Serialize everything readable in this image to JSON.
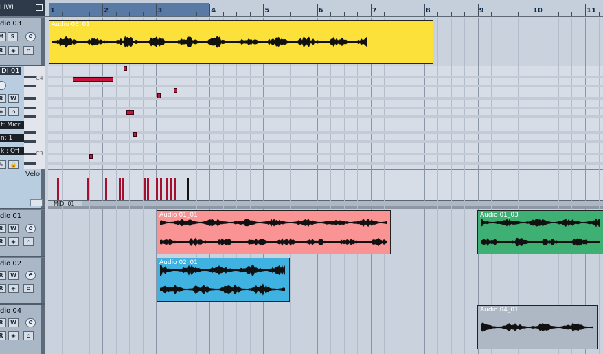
{
  "topleft": {
    "label": "I IWI"
  },
  "ruler": {
    "bars": [
      "1",
      "2",
      "3",
      "4",
      "5",
      "6",
      "7",
      "8",
      "9",
      "10",
      "11"
    ],
    "locators": {
      "left_bar": 1,
      "right_bar": 4
    }
  },
  "tracks": [
    {
      "name": "dio 03",
      "type": "audio"
    },
    {
      "name": "DI 01",
      "type": "midi",
      "fields": [
        "t: Micr",
        "n: 1",
        "k : Off"
      ]
    },
    {
      "name": "dio 01",
      "type": "audio"
    },
    {
      "name": "dio 02",
      "type": "audio"
    },
    {
      "name": "dio 04",
      "type": "audio"
    }
  ],
  "buttons": {
    "m": "M",
    "s": "S",
    "r": "R",
    "w": "W",
    "e": "e"
  },
  "clips": [
    {
      "name": "Audio 03_01",
      "color": "#fce13a"
    },
    {
      "name": "Audio 01_01",
      "color": "#f99394"
    },
    {
      "name": "Audio 01_03",
      "color": "#3fb073"
    },
    {
      "name": "Audio 02_01",
      "color": "#3fb2e2"
    },
    {
      "name": "Audio 04_01",
      "color": "#aeb8c4"
    }
  ],
  "editor": {
    "pitch_labels": [
      "C4",
      "C3"
    ],
    "velocity_label": "Velo",
    "part_name": "MIDI 01",
    "notes": [
      {
        "start_beat": 1.8,
        "length_beats": 3.0,
        "row": 4
      },
      {
        "start_beat": 5.6,
        "length_beats": 0.25,
        "row": 0
      },
      {
        "start_beat": 8.1,
        "length_beats": 0.2,
        "row": 10
      },
      {
        "start_beat": 9.3,
        "length_beats": 0.2,
        "row": 8
      },
      {
        "start_beat": 5.8,
        "length_beats": 0.55,
        "row": 16
      },
      {
        "start_beat": 6.3,
        "length_beats": 0.2,
        "row": 24
      },
      {
        "start_beat": 3.0,
        "length_beats": 0.25,
        "row": 32
      }
    ],
    "velocities": [
      0.85,
      0.85,
      0.85,
      0.85,
      0.85,
      0.85,
      0.85,
      0.85,
      0.85,
      0.85,
      0.85,
      0.85,
      0.85
    ],
    "velocity_beats": [
      0.3,
      2.5,
      3.9,
      4.9,
      5.1,
      6.8,
      7.0,
      7.7,
      8.0,
      8.4,
      8.7,
      9.0,
      10.0
    ]
  },
  "playback": {
    "position_bar": 2.15
  }
}
